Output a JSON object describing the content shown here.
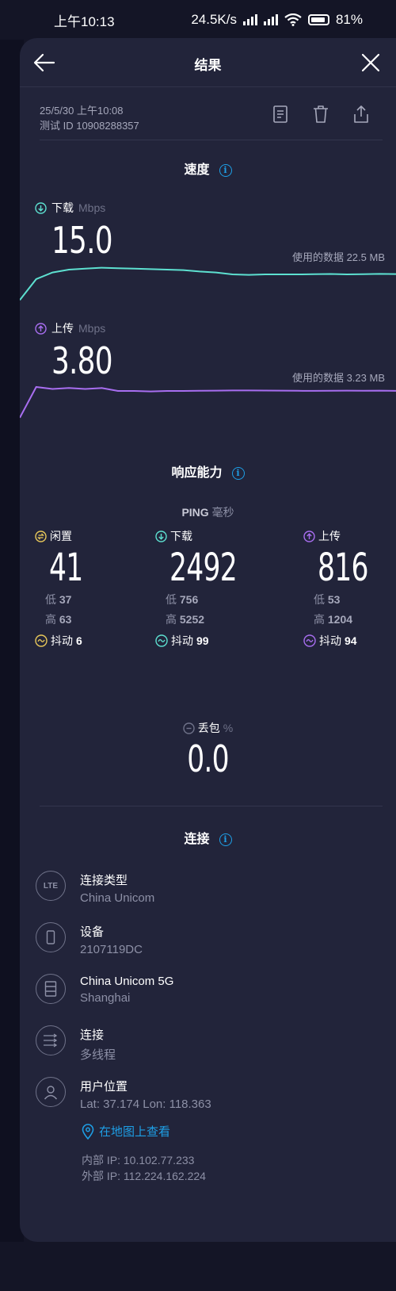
{
  "status_bar": {
    "time": "上午10:13",
    "net_speed": "24.5K/s",
    "battery": "81%"
  },
  "header": {
    "title": "结果"
  },
  "meta": {
    "datetime": "25/5/30 上午10:08",
    "test_id": "测试 ID 10908288357"
  },
  "speed": {
    "title": "速度",
    "download": {
      "label": "下载",
      "unit": "Mbps",
      "value": "15.0",
      "used": "使用的数据 22.5 MB",
      "color": "#5de0d0"
    },
    "upload": {
      "label": "上传",
      "unit": "Mbps",
      "value": "3.80",
      "used": "使用的数据 3.23 MB",
      "color": "#a86ef0"
    }
  },
  "responsiveness": {
    "title": "响应能力",
    "ping_label": "PING",
    "ping_unit": "毫秒",
    "idle": {
      "label": "闲置",
      "value": "41",
      "low": "低",
      "low_val": "37",
      "high": "高",
      "high_val": "63",
      "jitter": "抖动",
      "jitter_val": "6",
      "color": "#e8c85a"
    },
    "download": {
      "label": "下载",
      "value": "2492",
      "low": "低",
      "low_val": "756",
      "high": "高",
      "high_val": "5252",
      "jitter": "抖动",
      "jitter_val": "99",
      "color": "#5de0d0"
    },
    "upload": {
      "label": "上传",
      "value": "816",
      "low": "低",
      "low_val": "53",
      "high": "高",
      "high_val": "1204",
      "jitter": "抖动",
      "jitter_val": "94",
      "color": "#a86ef0"
    },
    "loss": {
      "label": "丢包",
      "unit": "%",
      "value": "0.0"
    }
  },
  "connection": {
    "title": "连接",
    "items": [
      {
        "icon_text": "LTE",
        "title": "连接类型",
        "sub": "China Unicom"
      },
      {
        "title": "设备",
        "sub": "2107119DC"
      },
      {
        "title": "China Unicom 5G",
        "sub": "Shanghai"
      },
      {
        "title": "连接",
        "sub": "多线程"
      },
      {
        "title": "用户位置",
        "sub": "Lat: 37.174 Lon: 118.363"
      }
    ],
    "map_link": "在地图上查看",
    "internal_ip": "内部 IP: 10.102.77.233",
    "external_ip": "外部 IP: 112.224.162.224"
  },
  "series": {
    "download_curve": [
      8,
      30,
      37,
      40,
      41,
      42,
      41.5,
      41,
      40.5,
      40,
      39.5,
      38,
      37,
      35,
      34.5,
      35,
      35,
      35,
      35.2,
      35.4,
      35,
      35.2,
      35.5,
      35.3
    ],
    "upload_curve": [
      5,
      36,
      34,
      35,
      34,
      35,
      32,
      32,
      31.5,
      32,
      32,
      32.2,
      32.3,
      32.5,
      32.5,
      32.4,
      32.3,
      32.2,
      32.1,
      32.2,
      32.3,
      32.2,
      32.3,
      32.1
    ]
  }
}
